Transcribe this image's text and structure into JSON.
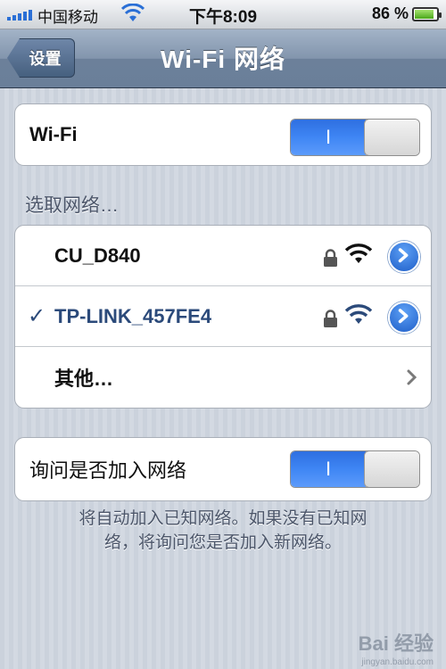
{
  "status_bar": {
    "carrier": "中国移动",
    "time": "下午8:09",
    "battery": "86 %",
    "battery_level": 0.86
  },
  "nav": {
    "back_label": "设置",
    "title": "Wi-Fi 网络"
  },
  "wifi_toggle": {
    "label": "Wi-Fi",
    "on_text": "I",
    "state": "on"
  },
  "section_header": "选取网络…",
  "networks": [
    {
      "name": "CU_D840",
      "selected": false,
      "locked": true
    },
    {
      "name": "TP-LINK_457FE4",
      "selected": true,
      "locked": true
    }
  ],
  "other": {
    "label": "其他…"
  },
  "ask_toggle": {
    "label": "询问是否加入网络",
    "on_text": "I",
    "state": "on"
  },
  "footer": {
    "line1": "将自动加入已知网络。如果没有已知网",
    "line2": "络，将询问您是否加入新网络。"
  },
  "watermark": {
    "text": "Bai 经验",
    "url": "jingyan.baidu.com"
  },
  "colors": {
    "accent": "#3f86f4",
    "selected_text": "#2b4a7a",
    "nav_bar": "#8295ad"
  }
}
